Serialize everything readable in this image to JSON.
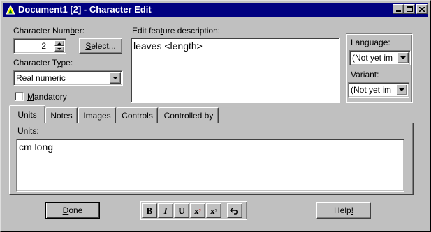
{
  "window": {
    "title": "Document1 [2] - Character Edit",
    "caption_buttons": {
      "minimize": "_",
      "maximize": "□",
      "close": "×"
    }
  },
  "character_number": {
    "label_pre": "Character Num",
    "label_accel": "b",
    "label_post": "er:",
    "value": "2"
  },
  "select_button": {
    "pre": "",
    "accel": "S",
    "post": "elect..."
  },
  "character_type": {
    "label_pre": "Character T",
    "label_accel": "y",
    "label_post": "pe:",
    "value": "Real numeric"
  },
  "mandatory": {
    "accel": "M",
    "post": "andatory",
    "checked": false
  },
  "feature_description": {
    "label_pre": "Edit fea",
    "label_accel": "t",
    "label_post": "ure description:",
    "value": "leaves <length>"
  },
  "language": {
    "label": "Language:",
    "value": "(Not yet im"
  },
  "variant": {
    "label": "Variant:",
    "value": "(Not yet im"
  },
  "tabs": [
    {
      "label": "Units",
      "active": true
    },
    {
      "label": "Notes",
      "active": false
    },
    {
      "label": "Images",
      "active": false
    },
    {
      "label": "Controls",
      "active": false
    },
    {
      "label": "Controlled by",
      "active": false
    }
  ],
  "units_panel": {
    "label": "Units:",
    "value": "cm long"
  },
  "format_toolbar": {
    "bold": "B",
    "italic": "I",
    "underline": "U",
    "superscript": "x",
    "superscript_mark": "2",
    "subscript": "x",
    "subscript_mark": "2",
    "undo_icon": "undo-icon"
  },
  "done_button": {
    "pre": "",
    "accel": "D",
    "post": "one"
  },
  "help_button": {
    "pre": "Help",
    "accel": "!",
    "post": ""
  },
  "colors": {
    "titlebar": "#000080",
    "face": "#c0c0c0",
    "window_bg": "#ffffff"
  }
}
